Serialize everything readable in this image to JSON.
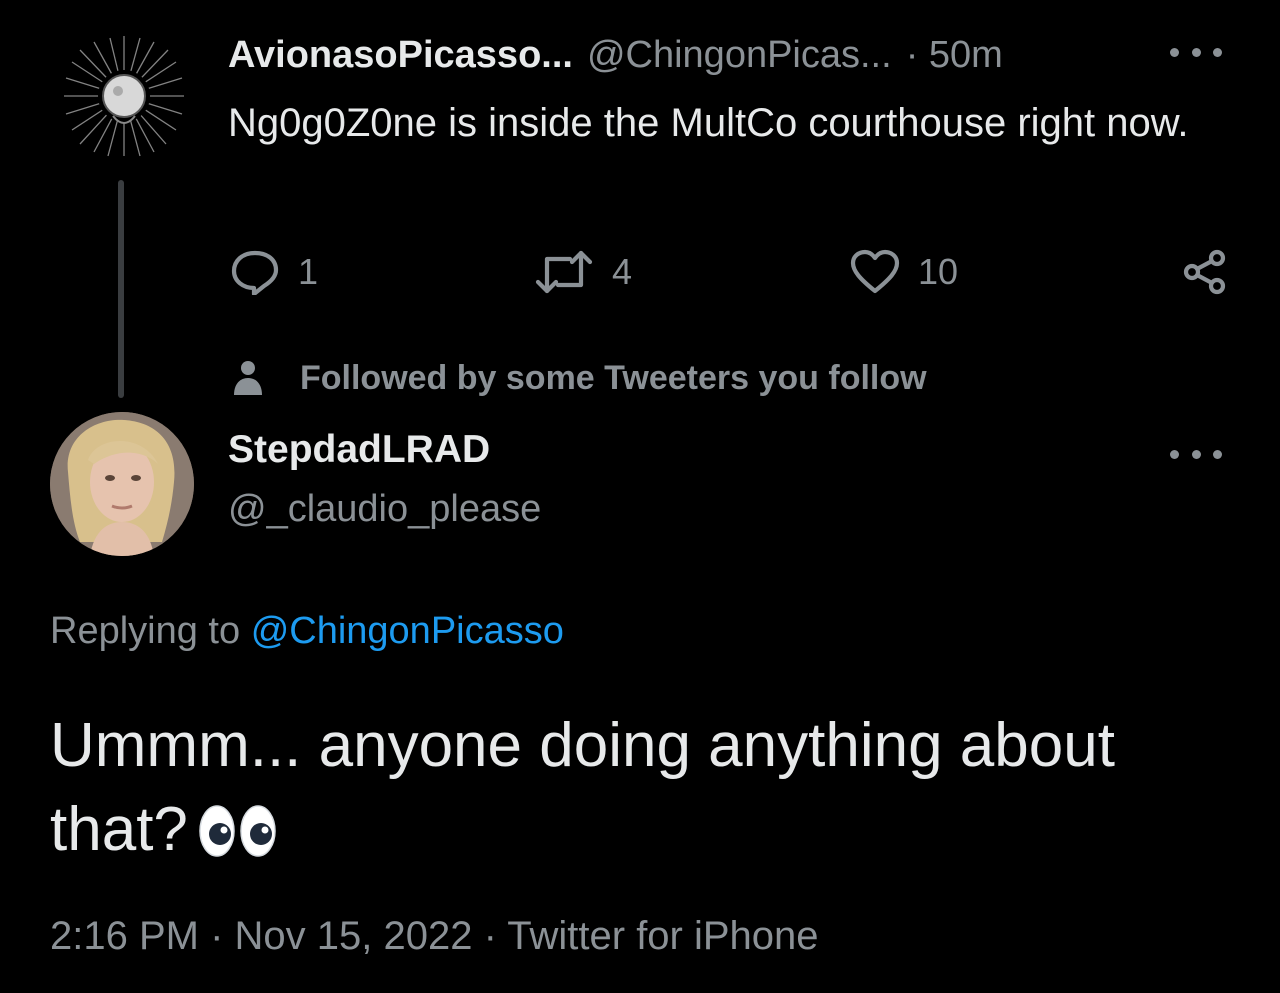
{
  "parent_tweet": {
    "display_name": "AvionasoPicasso...",
    "handle": "@ChingonPicas...",
    "time": "· 50m",
    "text": "Ng0g0Z0ne is inside the MultCo courthouse right now.",
    "avatar_icon": "dandelion-avatar",
    "actions": {
      "reply_count": "1",
      "retweet_count": "4",
      "like_count": "10"
    },
    "social_context": "Followed by some Tweeters you follow"
  },
  "reply_tweet": {
    "display_name": "StepdadLRAD",
    "handle": "@_claudio_please",
    "replying_prefix": "Replying to",
    "replying_mention": "@ChingonPicasso",
    "text": "Ummm... anyone doing anything about that?",
    "emoji": "eyes-emoji",
    "meta": "2:16 PM · Nov 15, 2022 · Twitter for iPhone"
  },
  "colors": {
    "background": "#000000",
    "primary_text": "#e7e9ea",
    "secondary_text": "#8b9196",
    "link": "#1d9bf0",
    "thread_line": "#3a3d40"
  }
}
